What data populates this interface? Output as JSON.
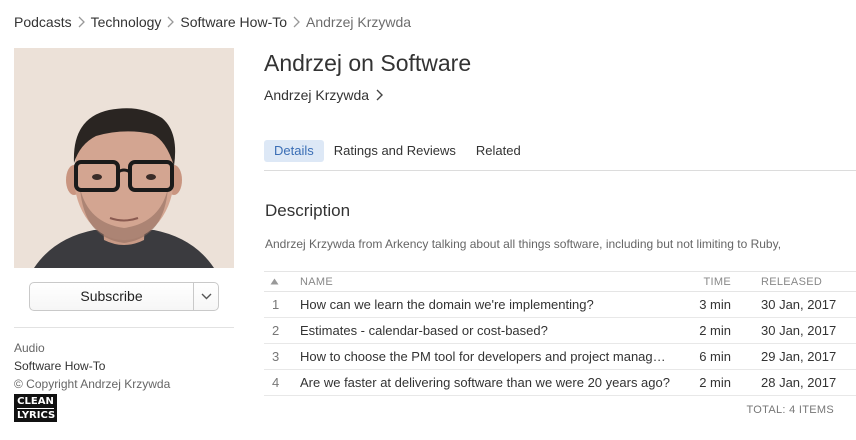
{
  "breadcrumb": {
    "items": [
      "Podcasts",
      "Technology",
      "Software How-To",
      "Andrzej Krzywda"
    ]
  },
  "podcast": {
    "title": "Andrzej on Software",
    "artist": "Andrzej Krzywda"
  },
  "subscribe": {
    "label": "Subscribe",
    "dropdown_icon": "chevron-down-icon"
  },
  "sidebar_meta": {
    "type": "Audio",
    "category": "Software How-To",
    "copyright": "© Copyright Andrzej Krzywda",
    "badge": {
      "top": "CLEAN",
      "bottom": "LYRICS"
    }
  },
  "tabs": [
    {
      "label": "Details",
      "active": true
    },
    {
      "label": "Ratings and Reviews",
      "active": false
    },
    {
      "label": "Related",
      "active": false
    }
  ],
  "description": {
    "heading": "Description",
    "text": "Andrzej Krzywda from Arkency talking about all things software, including but not limiting to Ruby,"
  },
  "episodes": {
    "columns": {
      "sort_icon": "sort-ascending-icon",
      "name": "NAME",
      "time": "TIME",
      "released": "RELEASED"
    },
    "rows": [
      {
        "num": "1",
        "name": "How can we learn the domain we're implementing?",
        "time": "3 min",
        "released": "30 Jan, 2017"
      },
      {
        "num": "2",
        "name": "Estimates - calendar-based or cost-based?",
        "time": "2 min",
        "released": "30 Jan, 2017"
      },
      {
        "num": "3",
        "name": "How to choose the PM tool for developers and project managers?",
        "time": "6 min",
        "released": "29 Jan, 2017"
      },
      {
        "num": "4",
        "name": "Are we faster at delivering software than we were 20 years ago?",
        "time": "2 min",
        "released": "28 Jan, 2017"
      }
    ],
    "total": "TOTAL: 4 ITEMS"
  },
  "colors": {
    "active_tab_bg": "#dde8f6",
    "active_tab_text": "#3b6eb5",
    "artwork_bg": "#efe4dc"
  }
}
